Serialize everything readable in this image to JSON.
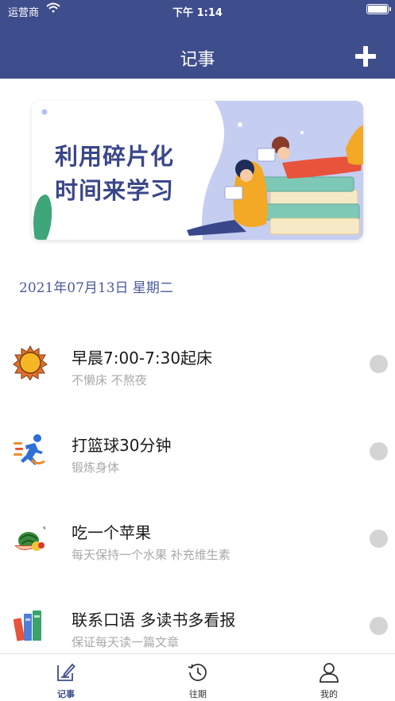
{
  "status_bar": {
    "carrier": "运营商",
    "time": "下午 1:14"
  },
  "nav": {
    "title": "记事",
    "add_icon": "plus-icon"
  },
  "banner": {
    "line1": "利用碎片化",
    "line2": "时间来学习"
  },
  "date": "2021年07月13日   星期二",
  "items": [
    {
      "title": "早晨7:00-7:30起床",
      "subtitle": "不懒床 不熬夜",
      "icon": "sun-icon"
    },
    {
      "title": "打篮球30分钟",
      "subtitle": "锻炼身体",
      "icon": "running-icon"
    },
    {
      "title": "吃一个苹果",
      "subtitle": "每天保持一个水果 补充维生素",
      "icon": "fruit-icon"
    },
    {
      "title": "联系口语 多读书多看报",
      "subtitle": "保证每天读一篇文章",
      "icon": "books-icon"
    }
  ],
  "tabs": [
    {
      "label": "记事",
      "icon": "note-edit-icon",
      "active": true
    },
    {
      "label": "往期",
      "icon": "history-icon",
      "active": false
    },
    {
      "label": "我的",
      "icon": "person-icon",
      "active": false
    }
  ],
  "colors": {
    "primary": "#3e4d8c",
    "check_gray": "#d4d4d4",
    "subtitle_gray": "#a9a9a9"
  }
}
